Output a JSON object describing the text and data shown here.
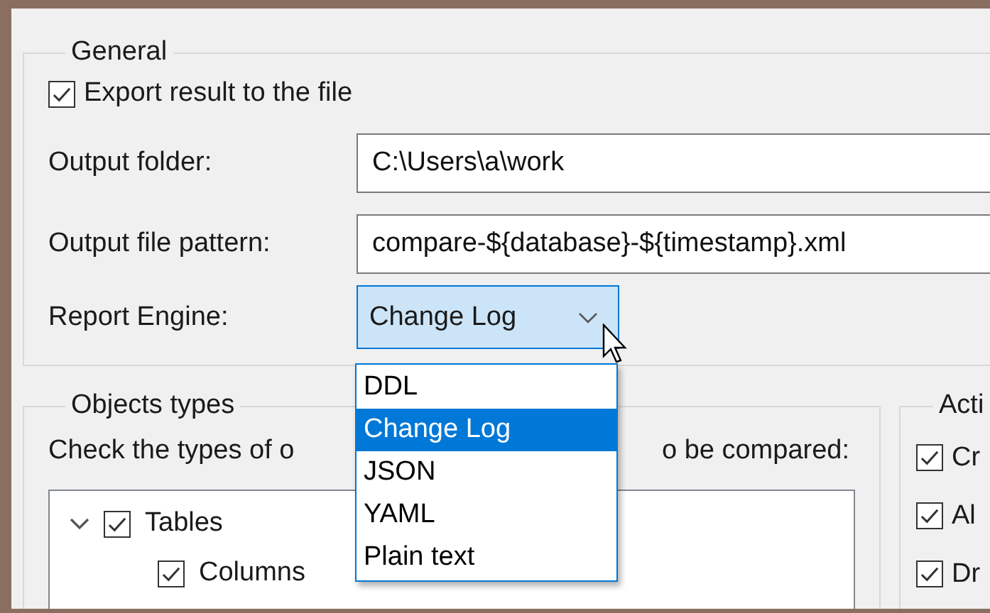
{
  "general": {
    "title": "General",
    "export_checkbox": {
      "label": "Export result to the file",
      "checked": true
    },
    "output_folder": {
      "label": "Output folder:",
      "value": "C:\\Users\\a\\work"
    },
    "output_file_pattern": {
      "label": "Output file pattern:",
      "value": "compare-${database}-${timestamp}.xml"
    },
    "report_engine": {
      "label": "Report Engine:",
      "value": "Change Log",
      "expanded": true,
      "options": [
        {
          "label": "DDL",
          "selected": false
        },
        {
          "label": "Change Log",
          "selected": true
        },
        {
          "label": "JSON",
          "selected": false
        },
        {
          "label": "YAML",
          "selected": false
        },
        {
          "label": "Plain text",
          "selected": false
        }
      ]
    }
  },
  "objects_types": {
    "title": "Objects types",
    "hint_parts": [
      "Check the types of o",
      "o be compared:"
    ],
    "tree": [
      {
        "label": "Tables",
        "checked": true,
        "expanded": true,
        "children": [
          {
            "label": "Columns",
            "checked": true
          }
        ]
      }
    ]
  },
  "actions": {
    "title": "Acti",
    "items": [
      {
        "label": "Cr",
        "checked": true
      },
      {
        "label": "Al",
        "checked": true
      },
      {
        "label": "Dr",
        "checked": true
      }
    ]
  }
}
